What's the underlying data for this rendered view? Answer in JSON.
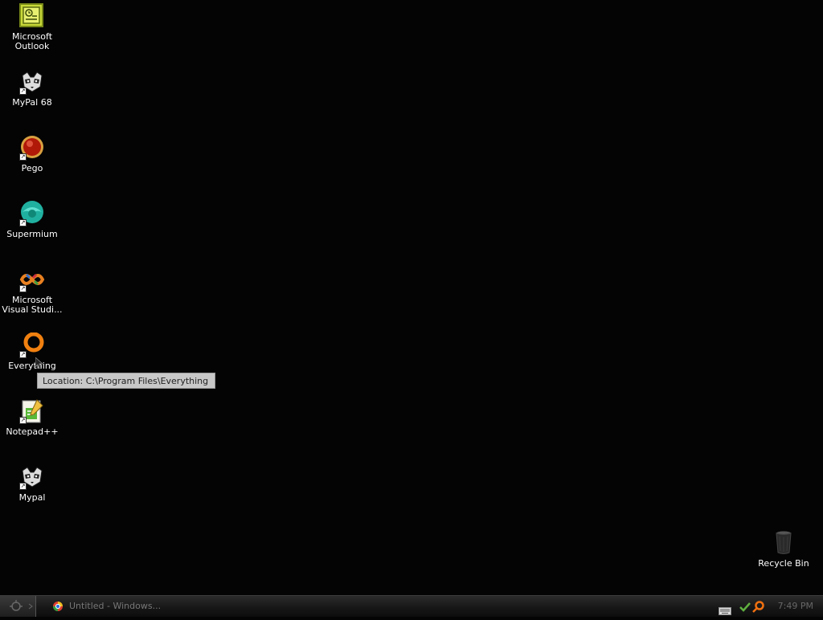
{
  "desktop": {
    "icons": [
      {
        "name": "microsoft-outlook-icon",
        "label1": "Microsoft",
        "label2": "Outlook"
      },
      {
        "name": "mypal-68-icon",
        "label1": "MyPal 68"
      },
      {
        "name": "pego-icon",
        "label1": "Pego"
      },
      {
        "name": "supermium-icon",
        "label1": "Supermium"
      },
      {
        "name": "visual-studio-icon",
        "label1": "Microsoft",
        "label2": "Visual Studi..."
      },
      {
        "name": "everything-icon",
        "label1": "Everything"
      },
      {
        "name": "notepadpp-icon",
        "label1": "Notepad++"
      },
      {
        "name": "mypal-icon",
        "label1": "Mypal"
      }
    ],
    "recycle_bin": {
      "label": "Recycle Bin"
    }
  },
  "tooltip": {
    "text": "Location: C:\\Program Files\\Everything"
  },
  "taskbar": {
    "task_label": "Untitled - Windows...",
    "clock": "7:49 PM"
  },
  "colors": {
    "background": "#040404",
    "tooltip_bg": "#c8c8c8",
    "taskbar_bg": "#1a1a1a"
  }
}
